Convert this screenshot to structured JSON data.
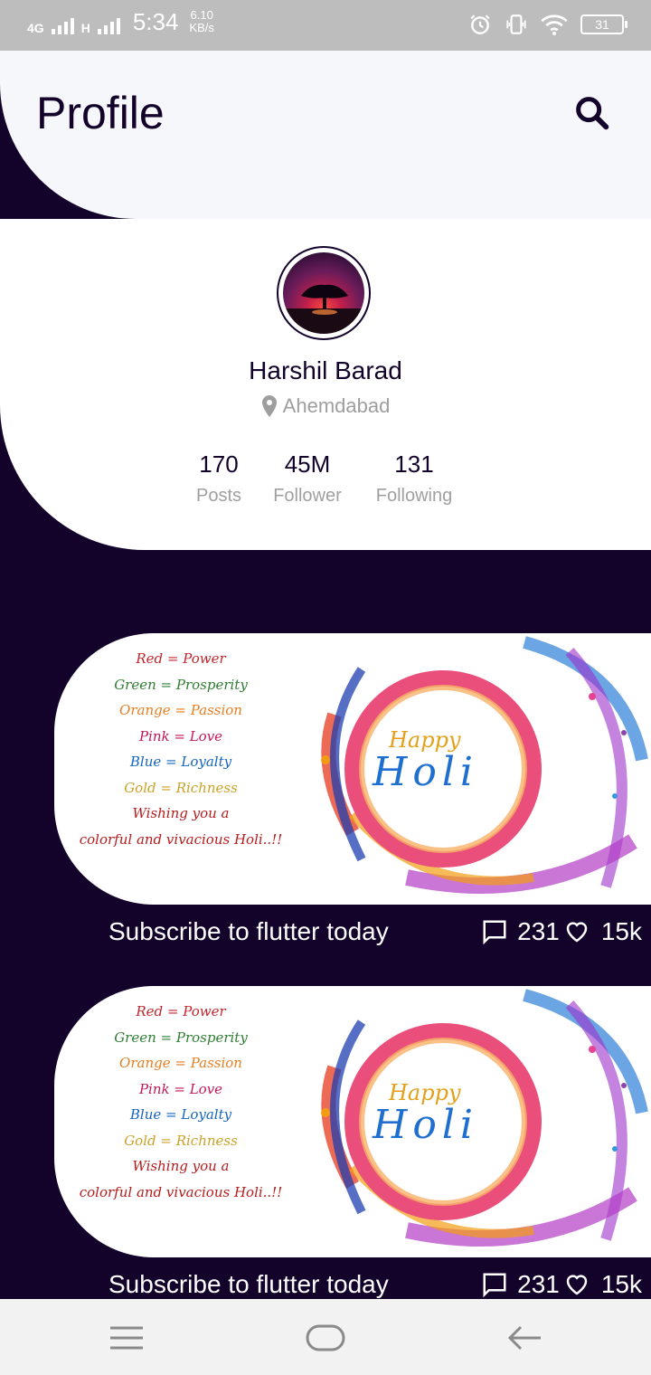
{
  "status_bar": {
    "network": "4G",
    "network2": "H",
    "time": "5:34",
    "speed_value": "6.10",
    "speed_unit": "KB/s",
    "battery": "31"
  },
  "header": {
    "title": "Profile"
  },
  "profile": {
    "name": "Harshil Barad",
    "location": "Ahemdabad",
    "stats": [
      {
        "value": "170",
        "label": "Posts"
      },
      {
        "value": "45M",
        "label": "Follower"
      },
      {
        "value": "131",
        "label": "Following"
      }
    ]
  },
  "posts": [
    {
      "lines": [
        "Red = Power",
        "Green = Prosperity",
        "Orange = Passion",
        "Pink = Love",
        "Blue = Loyalty",
        "Gold = Richness",
        "Wishing you a",
        "colorful and vivacious Holi..!!"
      ],
      "greeting_top": "Happy",
      "greeting_main": "Holi",
      "caption": "Subscribe to flutter today",
      "comments": "231",
      "likes": "15k"
    },
    {
      "lines": [
        "Red = Power",
        "Green = Prosperity",
        "Orange = Passion",
        "Pink = Love",
        "Blue = Loyalty",
        "Gold = Richness",
        "Wishing you a",
        "colorful and vivacious Holi..!!"
      ],
      "greeting_top": "Happy",
      "greeting_main": "Holi",
      "caption": "Subscribe to flutter today",
      "comments": "231",
      "likes": "15k"
    }
  ],
  "colors": {
    "background": "#13022a",
    "header": "#f5f7fa",
    "card": "#ffffff",
    "muted": "#9e9e9e"
  },
  "icons": [
    "search-icon",
    "location-pin-icon",
    "comment-icon",
    "heart-icon",
    "menu-icon",
    "home-icon",
    "back-icon"
  ]
}
